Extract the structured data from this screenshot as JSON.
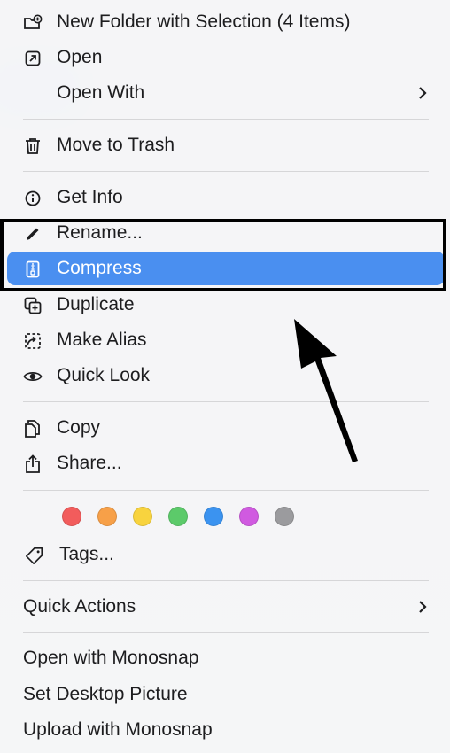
{
  "menu": {
    "items": [
      {
        "label": "New Folder with Selection (4 Items)",
        "icon": "folder-plus-icon"
      },
      {
        "label": "Open",
        "icon": "open-arrow-icon"
      },
      {
        "label": "Open With",
        "icon": "chevron-right-icon"
      },
      {
        "label": "Move to Trash",
        "icon": "trash-icon"
      },
      {
        "label": "Get Info",
        "icon": "info-icon"
      },
      {
        "label": "Rename...",
        "icon": "pencil-icon"
      },
      {
        "label": "Compress",
        "icon": "zip-file-icon"
      },
      {
        "label": "Duplicate",
        "icon": "duplicate-icon"
      },
      {
        "label": "Make Alias",
        "icon": "alias-icon"
      },
      {
        "label": "Quick Look",
        "icon": "eye-icon"
      },
      {
        "label": "Copy",
        "icon": "copy-icon"
      },
      {
        "label": "Share...",
        "icon": "share-icon"
      },
      {
        "label": "Tags...",
        "icon": "tag-icon"
      },
      {
        "label": "Quick Actions",
        "icon": "chevron-right-icon"
      },
      {
        "label": "Open with Monosnap",
        "icon": ""
      },
      {
        "label": "Set Desktop Picture",
        "icon": ""
      },
      {
        "label": "Upload with Monosnap",
        "icon": ""
      }
    ],
    "tag_colors": [
      {
        "name": "red",
        "color": "#f25c5c"
      },
      {
        "name": "orange",
        "color": "#f7a048"
      },
      {
        "name": "yellow",
        "color": "#f8d33e"
      },
      {
        "name": "green",
        "color": "#5cca6a"
      },
      {
        "name": "blue",
        "color": "#3b93f0"
      },
      {
        "name": "purple",
        "color": "#d05ae0"
      },
      {
        "name": "gray",
        "color": "#9b9b9e"
      }
    ],
    "selected_color": "#4a8ff0",
    "annotation_color": "#000000"
  }
}
